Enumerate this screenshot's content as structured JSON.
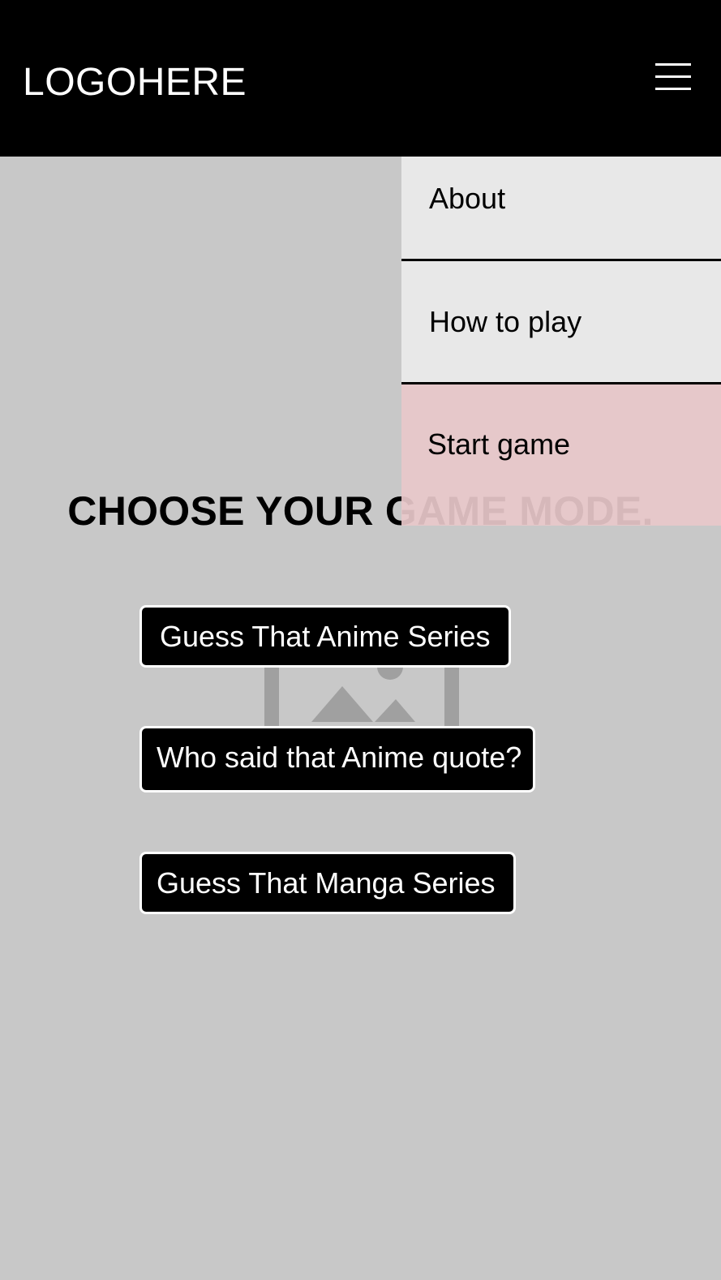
{
  "header": {
    "logo_text": "LOGOHERE",
    "menu_icon": "hamburger-menu-icon"
  },
  "menu": {
    "items": [
      {
        "label": "About"
      },
      {
        "label": "How to play"
      },
      {
        "label": "Start game",
        "highlighted": true
      }
    ]
  },
  "main": {
    "heading": "CHOOSE YOUR GAME MODE.",
    "background_icon": "image-placeholder-icon",
    "buttons": [
      {
        "label": "Guess That Anime Series"
      },
      {
        "label": "Who said that Anime quote?"
      },
      {
        "label": "Guess That Manga Series"
      }
    ]
  },
  "colors": {
    "header_bg": "#000000",
    "page_bg": "#c8c8c8",
    "menu_bg": "#e8e8e8",
    "menu_highlight_bg": "#e8c8ca",
    "button_bg": "#000000",
    "button_text": "#ffffff"
  }
}
